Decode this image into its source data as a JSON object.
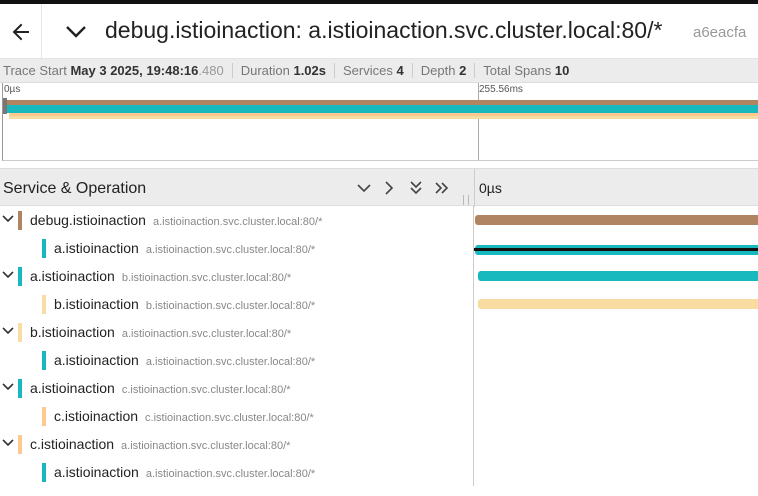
{
  "header": {
    "title": "debug.istioinaction: a.istioinaction.svc.cluster.local:80/*",
    "trace_id": "a6eacfa",
    "back_icon": "arrow-left-icon",
    "collapse_icon": "chevron-down-icon"
  },
  "meta": {
    "trace_start_label": "Trace Start",
    "trace_start_value": "May 3 2025, 19:48:16",
    "trace_start_ms": ".480",
    "duration_label": "Duration",
    "duration_value": "1.02s",
    "services_label": "Services",
    "services_value": "4",
    "depth_label": "Depth",
    "depth_value": "2",
    "total_spans_label": "Total Spans",
    "total_spans_value": "10"
  },
  "minimap": {
    "tick_0": "0µs",
    "tick_1": "255.56ms"
  },
  "grid": {
    "column_title": "Service & Operation",
    "timeline_start": "0µs"
  },
  "colors": {
    "debug": "#b08460",
    "a": "#17b8be",
    "b": "#f8dca1",
    "c": "#ffc88f"
  },
  "rows": [
    {
      "service": "debug.istioinaction",
      "operation": "a.istioinaction.svc.cluster.local:80/*",
      "depth": 0,
      "expanded": true
    },
    {
      "service": "a.istioinaction",
      "operation": "a.istioinaction.svc.cluster.local:80/*",
      "depth": 1,
      "expanded": false
    },
    {
      "service": "a.istioinaction",
      "operation": "b.istioinaction.svc.cluster.local:80/*",
      "depth": 0,
      "expanded": true
    },
    {
      "service": "b.istioinaction",
      "operation": "b.istioinaction.svc.cluster.local:80/*",
      "depth": 1,
      "expanded": false
    },
    {
      "service": "b.istioinaction",
      "operation": "a.istioinaction.svc.cluster.local:80/*",
      "depth": 0,
      "expanded": true
    },
    {
      "service": "a.istioinaction",
      "operation": "a.istioinaction.svc.cluster.local:80/*",
      "depth": 1,
      "expanded": false
    },
    {
      "service": "a.istioinaction",
      "operation": "c.istioinaction.svc.cluster.local:80/*",
      "depth": 0,
      "expanded": true
    },
    {
      "service": "c.istioinaction",
      "operation": "c.istioinaction.svc.cluster.local:80/*",
      "depth": 1,
      "expanded": false
    },
    {
      "service": "c.istioinaction",
      "operation": "a.istioinaction.svc.cluster.local:80/*",
      "depth": 0,
      "expanded": true
    },
    {
      "service": "a.istioinaction",
      "operation": "a.istioinaction.svc.cluster.local:80/*",
      "depth": 1,
      "expanded": false
    }
  ]
}
